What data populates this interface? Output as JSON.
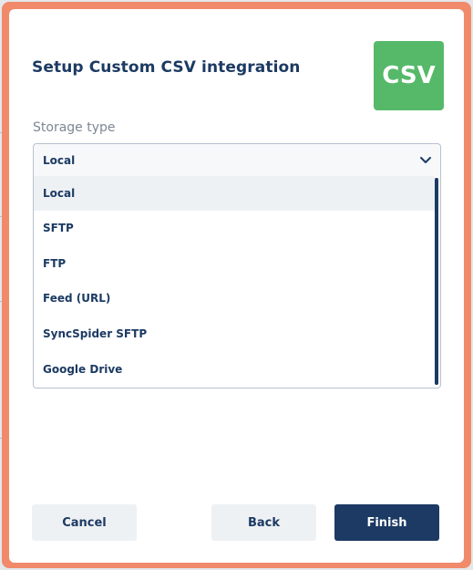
{
  "modal": {
    "title": "Setup Custom CSV integration",
    "logo_text": "CSV",
    "logo_color": "#56b969"
  },
  "storage": {
    "label": "Storage type",
    "selected": "Local",
    "options": [
      {
        "label": "Local",
        "selected": true
      },
      {
        "label": "SFTP",
        "selected": false
      },
      {
        "label": "FTP",
        "selected": false
      },
      {
        "label": "Feed (URL)",
        "selected": false
      },
      {
        "label": "SyncSpider SFTP",
        "selected": false
      },
      {
        "label": "Google Drive",
        "selected": false
      }
    ]
  },
  "buttons": {
    "cancel": "Cancel",
    "back": "Back",
    "finish": "Finish"
  },
  "colors": {
    "primary": "#1c3a63",
    "frame_accent": "#f08a6a"
  }
}
